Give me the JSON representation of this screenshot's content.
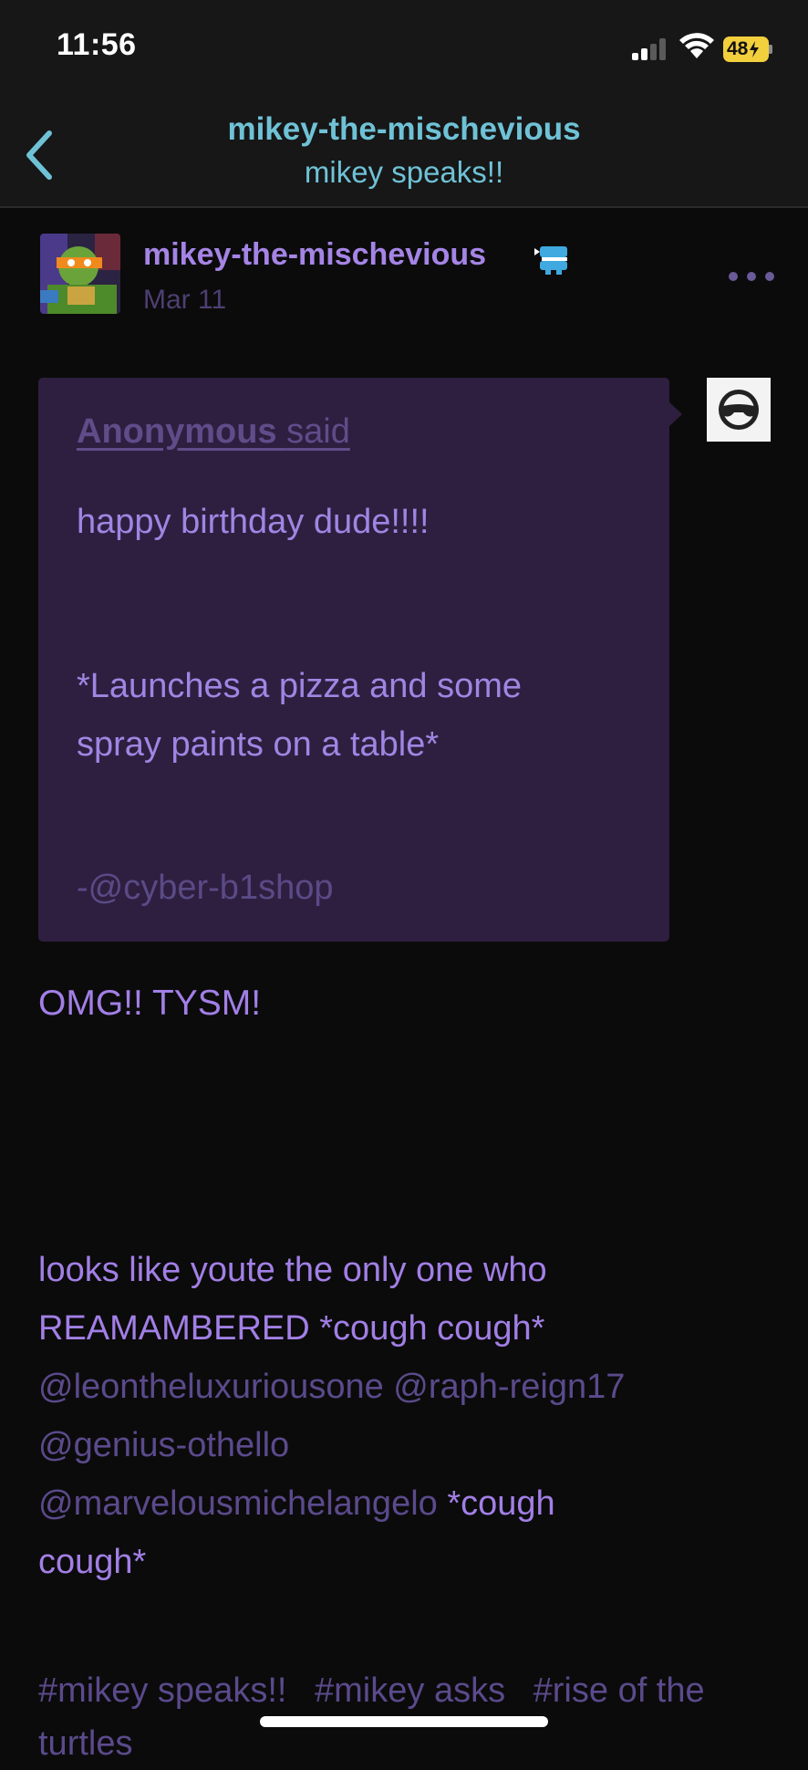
{
  "status_bar": {
    "time": "11:56",
    "battery_level": "48",
    "signal_bars_active": 2
  },
  "header": {
    "title": "mikey-the-mischevious",
    "subtitle": "mikey speaks!!",
    "back_icon": "chevron-left-icon",
    "accent_color": "#6fc2d6"
  },
  "post": {
    "author": "mikey-the-mischevious",
    "date": "Mar 11",
    "badge_icon": "chatter-teeth-icon",
    "more_icon": "ellipsis-icon",
    "ask": {
      "asker": "Anonymous",
      "said_label": "said",
      "lines": [
        "happy birthday dude!!!!",
        "*Launches a pizza and some",
        "spray paints on a table*"
      ],
      "signature": "-@cyber-b1shop",
      "asker_avatar_icon": "sunglasses-face-icon"
    },
    "reply_1": "OMG!! TYSM!",
    "reply_2": {
      "line_1": "looks like youte the only one who",
      "line_2": "REAMAMBERED *cough cough*",
      "mention_1": "@leontheluxuriousone",
      "mention_2": "@raph-reign17",
      "mention_3": "@genius-othello",
      "mention_4": "@marvelousmichelangelo",
      "tail_1": "*cough",
      "tail_2": "cough*"
    },
    "tags": [
      "#mikey speaks!!",
      "#mikey asks",
      "#rise of the turtles"
    ]
  },
  "colors": {
    "background": "#0b0b0b",
    "bar": "#171717",
    "accent_purple": "#a27fe6",
    "ask_box": "#2e1f40",
    "muted_purple": "#5b4a8c"
  }
}
